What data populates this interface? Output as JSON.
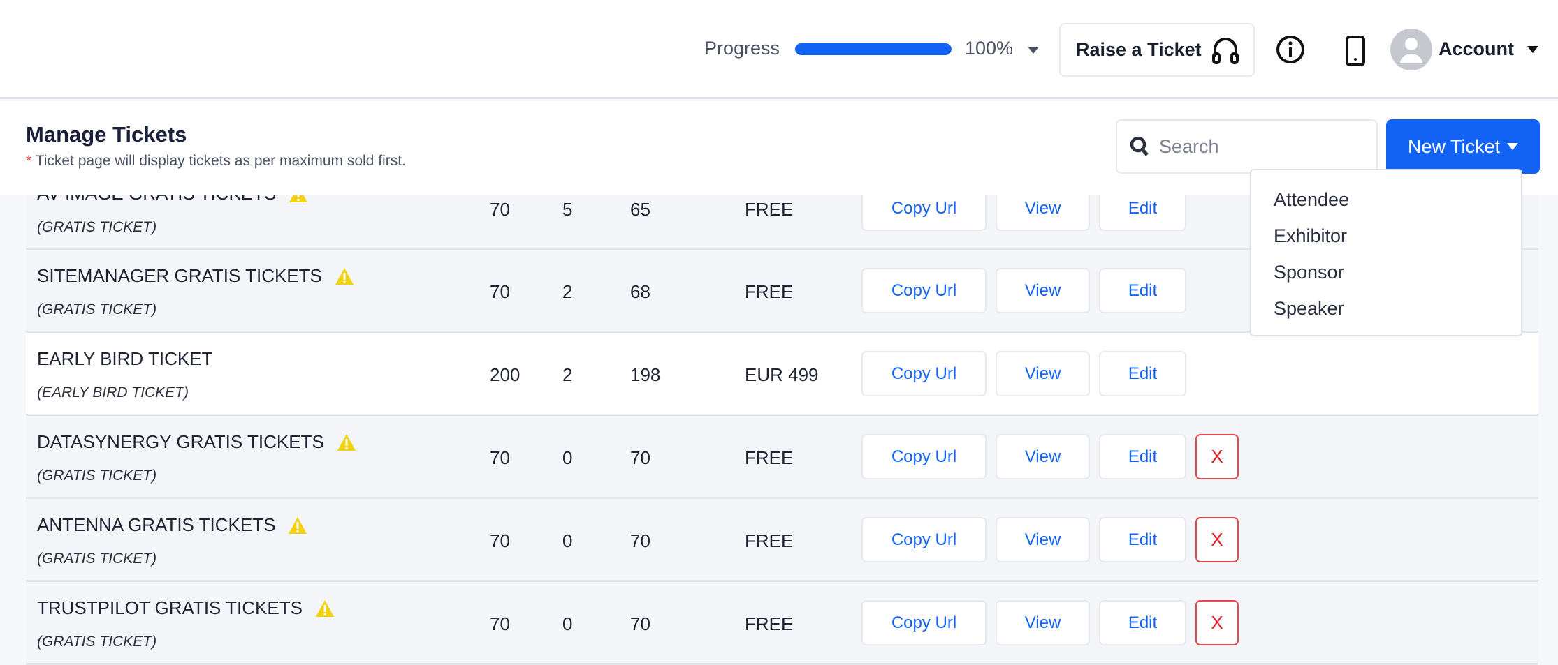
{
  "header": {
    "progress_label": "Progress",
    "progress_value": 100,
    "progress_text": "100%",
    "raise_ticket": "Raise a Ticket",
    "account": "Account"
  },
  "page": {
    "title": "Manage Tickets",
    "note_star": "*",
    "note": " Ticket page will display tickets as per maximum sold first.",
    "search_placeholder": "Search",
    "new_ticket": "New Ticket"
  },
  "dropdown": {
    "items": [
      "Attendee",
      "Exhibitor",
      "Sponsor",
      "Speaker"
    ]
  },
  "buttons": {
    "copy": "Copy Url",
    "view": "View",
    "edit": "Edit",
    "delete": "X"
  },
  "colors": {
    "accent": "#1262f5",
    "warning": "#f2d20f",
    "danger": "#e81c24"
  },
  "tickets": [
    {
      "name": "AV IMAGE GRATIS TICKETS",
      "type": "(GRATIS TICKET)",
      "total": "70",
      "sold": "5",
      "remaining": "65",
      "price": "FREE",
      "warning": true,
      "deletable": false
    },
    {
      "name": "SITEMANAGER GRATIS TICKETS",
      "type": "(GRATIS TICKET)",
      "total": "70",
      "sold": "2",
      "remaining": "68",
      "price": "FREE",
      "warning": true,
      "deletable": false
    },
    {
      "name": "EARLY BIRD TICKET",
      "type": "(EARLY BIRD TICKET)",
      "total": "200",
      "sold": "2",
      "remaining": "198",
      "price": "EUR 499",
      "warning": false,
      "deletable": false
    },
    {
      "name": "DATASYNERGY GRATIS TICKETS",
      "type": "(GRATIS TICKET)",
      "total": "70",
      "sold": "0",
      "remaining": "70",
      "price": "FREE",
      "warning": true,
      "deletable": true
    },
    {
      "name": "ANTENNA GRATIS TICKETS",
      "type": "(GRATIS TICKET)",
      "total": "70",
      "sold": "0",
      "remaining": "70",
      "price": "FREE",
      "warning": true,
      "deletable": true
    },
    {
      "name": "TRUSTPILOT GRATIS TICKETS",
      "type": "(GRATIS TICKET)",
      "total": "70",
      "sold": "0",
      "remaining": "70",
      "price": "FREE",
      "warning": true,
      "deletable": true
    }
  ]
}
